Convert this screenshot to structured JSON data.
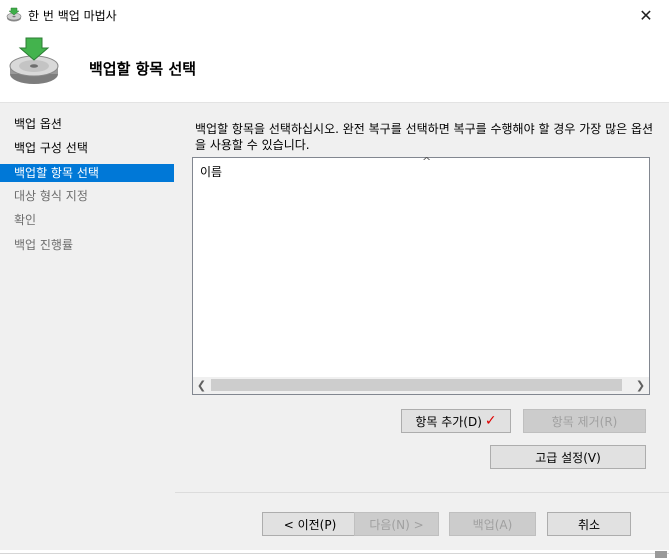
{
  "window": {
    "title": "한 번 백업 마법사",
    "close_glyph": "✕"
  },
  "header": {
    "title": "백업할 항목 선택",
    "icon": "backup-disk-icon"
  },
  "sidebar": {
    "items": [
      {
        "label": "백업 옵션",
        "state": "normal"
      },
      {
        "label": "백업 구성 선택",
        "state": "normal"
      },
      {
        "label": "백업할 항목 선택",
        "state": "active"
      },
      {
        "label": "대상 형식 지정",
        "state": "disabled"
      },
      {
        "label": "확인",
        "state": "disabled"
      },
      {
        "label": "백업 진행률",
        "state": "disabled"
      }
    ]
  },
  "main": {
    "description": "백업할 항목을 선택하십시오. 완전 복구를 선택하면 복구를 수행해야 할 경우 가장 많은 옵션을 사용할 수 있습니다.",
    "list": {
      "column_header": "이름",
      "sort_glyph": "^",
      "items": []
    },
    "buttons": {
      "add_items": "항목 추가(D)",
      "add_check": "✓",
      "remove_items": "항목 제거(R)",
      "advanced": "고급 설정(V)"
    }
  },
  "footer": {
    "previous": "< 이전(P)",
    "next": "다음(N) >",
    "backup": "백업(A)",
    "cancel": "취소"
  },
  "colors": {
    "accent": "#0078d7",
    "check": "#e00000",
    "panel": "#f0f0f0"
  }
}
